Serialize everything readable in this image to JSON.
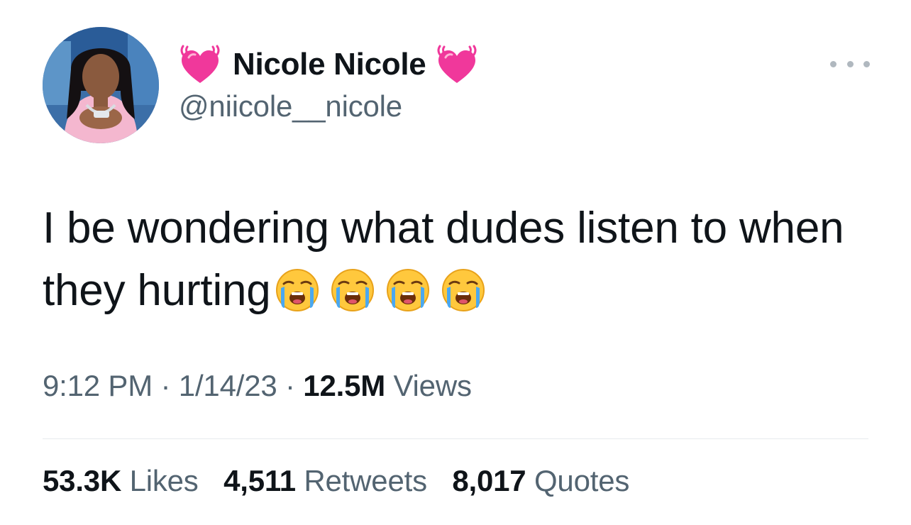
{
  "author": {
    "display_name": "Nicole Nicole",
    "handle": "@niicole__nicole",
    "name_decoration_icon": "beating-heart-icon",
    "avatar_icon": "profile-photo"
  },
  "tweet": {
    "text": "I be wondering what dudes listen to when they hurting",
    "emoji": [
      "loudly-crying-face",
      "loudly-crying-face",
      "loudly-crying-face",
      "loudly-crying-face"
    ]
  },
  "meta": {
    "time": "9:12 PM",
    "separator": "·",
    "date": "1/14/23",
    "views_count": "12.5M",
    "views_label": "Views"
  },
  "stats": {
    "likes_count": "53.3K",
    "likes_label": "Likes",
    "retweets_count": "4,511",
    "retweets_label": "Retweets",
    "quotes_count": "8,017",
    "quotes_label": "Quotes"
  },
  "more_menu_icon": "more-horizontal-icon",
  "colors": {
    "text": "#0f1419",
    "secondary_text": "#536471",
    "divider": "#e6eaed",
    "heart": "#f0389b"
  }
}
